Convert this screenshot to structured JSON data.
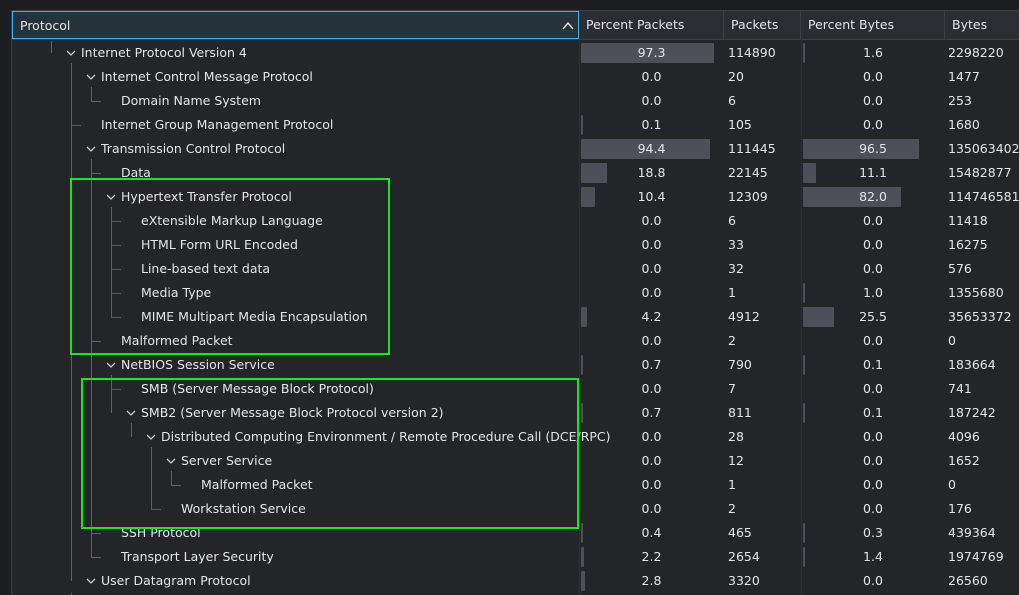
{
  "columns": [
    "Protocol",
    "Percent Packets",
    "Packets",
    "Percent Bytes",
    "Bytes"
  ],
  "rows": [
    {
      "depth": 1,
      "expand": true,
      "name": "Internet Protocol Version 4",
      "pp": "97.3",
      "pk": "114890",
      "pb": "1.6",
      "by": "2298220",
      "ppv": 97.3,
      "pbv": 1.6
    },
    {
      "depth": 2,
      "expand": true,
      "name": "Internet Control Message Protocol",
      "pp": "0.0",
      "pk": "20",
      "pb": "0.0",
      "by": "1477",
      "ppv": 0,
      "pbv": 0
    },
    {
      "depth": 3,
      "expand": false,
      "name": "Domain Name System",
      "pp": "0.0",
      "pk": "6",
      "pb": "0.0",
      "by": "253",
      "ppv": 0,
      "pbv": 0
    },
    {
      "depth": 2,
      "expand": false,
      "name": "Internet Group Management Protocol",
      "pp": "0.1",
      "pk": "105",
      "pb": "0.0",
      "by": "1680",
      "ppv": 0.1,
      "pbv": 0
    },
    {
      "depth": 2,
      "expand": true,
      "name": "Transmission Control Protocol",
      "pp": "94.4",
      "pk": "111445",
      "pb": "96.5",
      "by": "135063402",
      "ppv": 94.4,
      "pbv": 96.5
    },
    {
      "depth": 3,
      "expand": false,
      "name": "Data",
      "pp": "18.8",
      "pk": "22145",
      "pb": "11.1",
      "by": "15482877",
      "ppv": 18.8,
      "pbv": 11.1
    },
    {
      "depth": 3,
      "expand": true,
      "name": "Hypertext Transfer Protocol",
      "pp": "10.4",
      "pk": "12309",
      "pb": "82.0",
      "by": "114746581",
      "ppv": 10.4,
      "pbv": 82.0
    },
    {
      "depth": 4,
      "expand": false,
      "name": "eXtensible Markup Language",
      "pp": "0.0",
      "pk": "6",
      "pb": "0.0",
      "by": "11418",
      "ppv": 0,
      "pbv": 0
    },
    {
      "depth": 4,
      "expand": false,
      "name": "HTML Form URL Encoded",
      "pp": "0.0",
      "pk": "33",
      "pb": "0.0",
      "by": "16275",
      "ppv": 0,
      "pbv": 0
    },
    {
      "depth": 4,
      "expand": false,
      "name": "Line-based text data",
      "pp": "0.0",
      "pk": "32",
      "pb": "0.0",
      "by": "576",
      "ppv": 0,
      "pbv": 0
    },
    {
      "depth": 4,
      "expand": false,
      "name": "Media Type",
      "pp": "0.0",
      "pk": "1",
      "pb": "1.0",
      "by": "1355680",
      "ppv": 0,
      "pbv": 1.0
    },
    {
      "depth": 4,
      "expand": false,
      "name": "MIME Multipart Media Encapsulation",
      "pp": "4.2",
      "pk": "4912",
      "pb": "25.5",
      "by": "35653372",
      "ppv": 4.2,
      "pbv": 25.5
    },
    {
      "depth": 3,
      "expand": false,
      "name": "Malformed Packet",
      "pp": "0.0",
      "pk": "2",
      "pb": "0.0",
      "by": "0",
      "ppv": 0,
      "pbv": 0
    },
    {
      "depth": 3,
      "expand": true,
      "name": "NetBIOS Session Service",
      "pp": "0.7",
      "pk": "790",
      "pb": "0.1",
      "by": "183664",
      "ppv": 0.7,
      "pbv": 0.1
    },
    {
      "depth": 4,
      "expand": false,
      "name": "SMB (Server Message Block Protocol)",
      "pp": "0.0",
      "pk": "7",
      "pb": "0.0",
      "by": "741",
      "ppv": 0,
      "pbv": 0
    },
    {
      "depth": 4,
      "expand": true,
      "name": "SMB2 (Server Message Block Protocol version 2)",
      "pp": "0.7",
      "pk": "811",
      "pb": "0.1",
      "by": "187242",
      "ppv": 0.7,
      "pbv": 0.1
    },
    {
      "depth": 5,
      "expand": true,
      "name": "Distributed Computing Environment / Remote Procedure Call (DCE/RPC)",
      "pp": "0.0",
      "pk": "28",
      "pb": "0.0",
      "by": "4096",
      "ppv": 0,
      "pbv": 0
    },
    {
      "depth": 6,
      "expand": true,
      "name": "Server Service",
      "pp": "0.0",
      "pk": "12",
      "pb": "0.0",
      "by": "1652",
      "ppv": 0,
      "pbv": 0
    },
    {
      "depth": 7,
      "expand": false,
      "name": "Malformed Packet",
      "pp": "0.0",
      "pk": "1",
      "pb": "0.0",
      "by": "0",
      "ppv": 0,
      "pbv": 0
    },
    {
      "depth": 6,
      "expand": false,
      "name": "Workstation Service",
      "pp": "0.0",
      "pk": "2",
      "pb": "0.0",
      "by": "176",
      "ppv": 0,
      "pbv": 0
    },
    {
      "depth": 3,
      "expand": false,
      "name": "SSH Protocol",
      "pp": "0.4",
      "pk": "465",
      "pb": "0.3",
      "by": "439364",
      "ppv": 0.4,
      "pbv": 0.3
    },
    {
      "depth": 3,
      "expand": false,
      "name": "Transport Layer Security",
      "pp": "2.2",
      "pk": "2654",
      "pb": "1.4",
      "by": "1974769",
      "ppv": 2.2,
      "pbv": 1.4
    },
    {
      "depth": 2,
      "expand": true,
      "name": "User Datagram Protocol",
      "pp": "2.8",
      "pk": "3320",
      "pb": "0.0",
      "by": "26560",
      "ppv": 2.8,
      "pbv": 0
    }
  ],
  "colors": {
    "bar": "#4d5157",
    "highlight": "#1ee61e",
    "accent": "#3daee9"
  },
  "icons": {
    "sort": "sort-ascending-icon",
    "expand": "chevron-down-icon"
  }
}
